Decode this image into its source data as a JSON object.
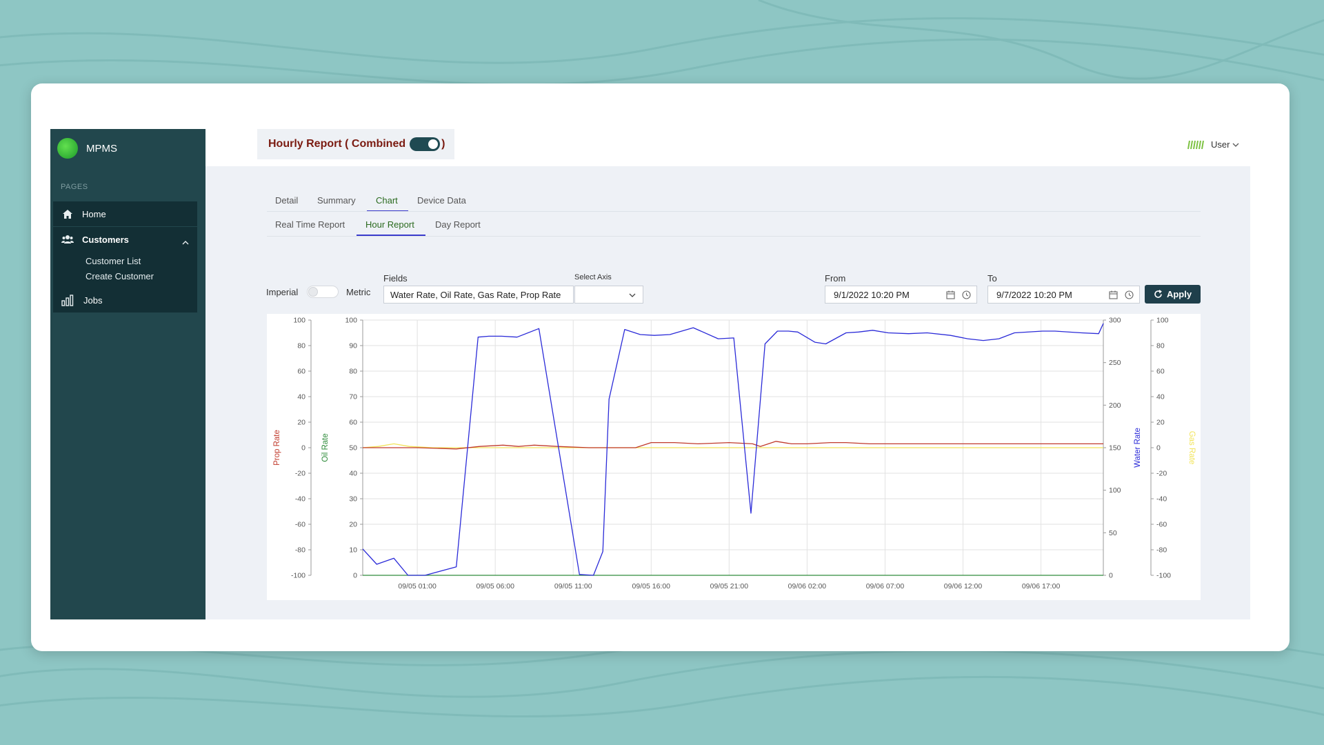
{
  "app": {
    "name": "MPMS"
  },
  "sidebar": {
    "section_label": "PAGES",
    "items": [
      {
        "label": "Home"
      },
      {
        "label": "Customers",
        "children": [
          {
            "label": "Customer List"
          },
          {
            "label": "Create Customer"
          }
        ]
      },
      {
        "label": "Jobs"
      }
    ]
  },
  "header": {
    "title": "Hourly Report ( Combined",
    "title_close": ")",
    "combined_toggle_on": true,
    "user_label": "User"
  },
  "tabs": {
    "main": [
      {
        "label": "Detail"
      },
      {
        "label": "Summary"
      },
      {
        "label": "Chart",
        "active": true
      },
      {
        "label": "Device Data"
      }
    ],
    "sub": [
      {
        "label": "Real Time Report"
      },
      {
        "label": "Hour Report",
        "active": true
      },
      {
        "label": "Day Report"
      }
    ]
  },
  "controls": {
    "unit_left": "Imperial",
    "unit_right": "Metric",
    "fields_label": "Fields",
    "fields_value": "Water Rate, Oil Rate, Gas Rate, Prop Rate",
    "select_axis_label": "Select Axis",
    "select_axis_value": "",
    "from_label": "From",
    "from_value": "9/1/2022 10:20 PM",
    "to_label": "To",
    "to_value": "9/7/2022 10:20 PM",
    "apply_label": "Apply"
  },
  "chart_data": {
    "type": "line",
    "x_ticks": [
      "09/05 01:00",
      "09/05 06:00",
      "09/05 11:00",
      "09/05 16:00",
      "09/05 21:00",
      "09/06 02:00",
      "09/06 07:00",
      "09/06 12:00",
      "09/06 17:00"
    ],
    "axes": [
      {
        "label": "Prop Rate",
        "color": "#c0392b",
        "side": "left",
        "range": [
          -100,
          100
        ],
        "ticks": [
          "100",
          "80",
          "60",
          "40",
          "20",
          "0",
          "-20",
          "-40",
          "-60",
          "-80",
          "-100"
        ]
      },
      {
        "label": "Oil Rate",
        "color": "#2e8b3a",
        "side": "left",
        "range": [
          0,
          100
        ],
        "ticks": [
          "100",
          "90",
          "80",
          "70",
          "60",
          "50",
          "40",
          "30",
          "20",
          "10",
          "0"
        ]
      },
      {
        "label": "Water Rate",
        "color": "#2a2ad8",
        "side": "right",
        "range": [
          0,
          300
        ],
        "ticks": [
          "300",
          "250",
          "200",
          "150",
          "100",
          "50",
          "0"
        ]
      },
      {
        "label": "Gas Rate",
        "color": "#f2e45a",
        "side": "right",
        "range": [
          -100,
          100
        ],
        "ticks": [
          "100",
          "80",
          "60",
          "40",
          "20",
          "0",
          "-20",
          "-40",
          "-60",
          "-80",
          "-100"
        ]
      }
    ],
    "x_range_hours": [
      -3.5,
      44
    ],
    "series": [
      {
        "name": "Water Rate",
        "axis": 2,
        "color": "#2a2ad8",
        "x": [
          -3.5,
          -2.6,
          -1.5,
          -0.6,
          0.5,
          2.5,
          3.9,
          4.6,
          5.4,
          6.4,
          7.8,
          10.4,
          11.3,
          11.9,
          12.3,
          13.3,
          14.3,
          15.2,
          16.2,
          17.7,
          19.3,
          20.3,
          21.4,
          22.3,
          23.1,
          23.8,
          24.4,
          25.5,
          26.2,
          27.5,
          28.3,
          29.2,
          30.2,
          31.5,
          32.7,
          34.2,
          35.3,
          36.3,
          37.3,
          38.3,
          40.1,
          40.9,
          42.6,
          43.7,
          44
        ],
        "y": [
          31,
          13,
          20,
          0,
          0,
          10,
          280,
          281,
          281,
          280,
          290,
          1,
          0,
          28,
          207,
          289,
          283,
          282,
          283,
          291,
          278,
          279,
          73,
          272,
          287,
          287,
          286,
          274,
          272,
          285,
          286,
          288,
          285,
          284,
          285,
          282,
          278,
          276,
          278,
          285,
          287,
          287,
          285,
          284,
          296
        ]
      },
      {
        "name": "Oil Rate",
        "axis": 1,
        "color": "#2e8b3a",
        "x": [
          -3.5,
          44
        ],
        "y": [
          0,
          0
        ]
      },
      {
        "name": "Prop Rate",
        "axis": 0,
        "color": "#c0392b",
        "x": [
          -3.5,
          0,
          2.5,
          4,
          5.5,
          6.5,
          7.5,
          9,
          11,
          13,
          14,
          15,
          16.5,
          18,
          20,
          21.5,
          22,
          23,
          24,
          25,
          26.5,
          27.5,
          29,
          30.5,
          32,
          33.5,
          35,
          37,
          39,
          41,
          42.5,
          44
        ],
        "y": [
          0,
          0,
          -1,
          1,
          2,
          1,
          2,
          1,
          0,
          0,
          0,
          4,
          4,
          3,
          4,
          3,
          1,
          5,
          3,
          3,
          4,
          4,
          3,
          3,
          3,
          3,
          3,
          3,
          3,
          3,
          3,
          3
        ]
      },
      {
        "name": "Gas Rate",
        "axis": 3,
        "color": "#f2e45a",
        "x": [
          -3.5,
          -2.5,
          -1.5,
          -0.5,
          1,
          5,
          10,
          20,
          30,
          44
        ],
        "y": [
          0,
          1,
          3,
          1,
          0,
          0,
          0,
          0,
          0,
          0
        ]
      }
    ]
  }
}
